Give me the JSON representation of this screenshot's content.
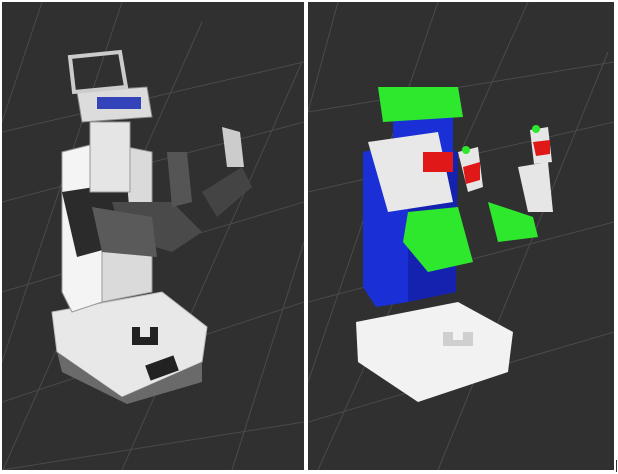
{
  "viewports": [
    {
      "name": "visual-model-view",
      "render_style": "textured",
      "background": "#303030",
      "grid_color": "#4a4a4a"
    },
    {
      "name": "collision-model-view",
      "render_style": "flat-colored",
      "background": "#303030",
      "grid_color": "#4a4a4a",
      "part_colors": {
        "body": "#1a2fd6",
        "arms": "#2ee82e",
        "grippers": "#e01818",
        "head": "#2ee82e",
        "base": "#f2f2f2"
      }
    }
  ]
}
